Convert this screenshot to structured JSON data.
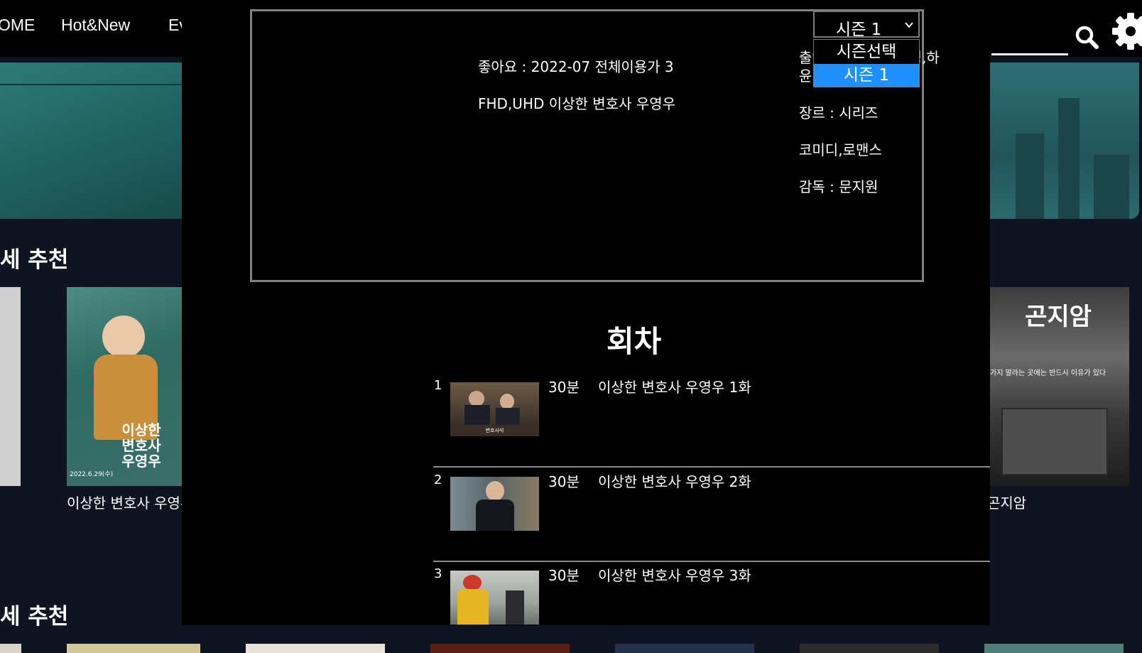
{
  "nav": {
    "items": [
      "OME",
      "Hot&New",
      "Ev"
    ],
    "icons": [
      "search-icon",
      "gear-icon"
    ]
  },
  "sections": [
    {
      "title": "세 추천"
    },
    {
      "title": "세 추천"
    }
  ],
  "posters": [
    {
      "caption": "이상한 변호사 우영우",
      "art_text": "이상한\n변호사\n우영우",
      "date_text": "2022.6.29(수)"
    },
    {
      "caption": "곤지암",
      "art_text": "곤지암",
      "tagline": "가지 말라는 곳에는 반드시 이유가 있다"
    }
  ],
  "detail": {
    "likes_line": "좋아요 : 2022-07 전체이용가 3",
    "quality_title": "FHD,UHD 이상한 변호사 우영우",
    "cast": "출연 : 박은빈,강기영,하윤경,주현영,강태오",
    "genre_label": "장르 : 시리즈",
    "genres": "코미디,로맨스",
    "director": "감독 : 문지원"
  },
  "season_select": {
    "value": "시즌 1",
    "options": [
      {
        "label": "시즌선택",
        "selected": false
      },
      {
        "label": "시즌 1",
        "selected": true
      }
    ],
    "highlight_color": "#1e90ff"
  },
  "episodes": {
    "title": "회차",
    "items": [
      {
        "number": "1",
        "duration": "30분",
        "title": "이상한 변호사 우영우 1화",
        "thumb_caption": "변호사석"
      },
      {
        "number": "2",
        "duration": "30분",
        "title": "이상한 변호사 우영우 2화"
      },
      {
        "number": "3",
        "duration": "30분",
        "title": "이상한 변호사 우영우 3화"
      }
    ]
  },
  "colors": {
    "page_background": "#101420",
    "modal_background": "#000000",
    "border_gray": "#808080",
    "text": "#ffffff"
  }
}
